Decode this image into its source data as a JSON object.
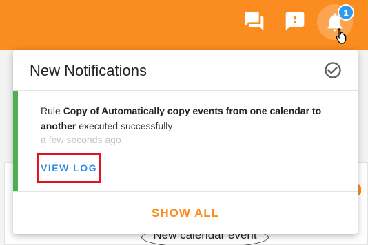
{
  "topbar": {
    "accent_color": "#fb8c1f",
    "icons": [
      "chat-icon",
      "feedback-icon",
      "bell-icon"
    ],
    "notification_count": "1"
  },
  "background": {
    "event_label": "New calendar event"
  },
  "notifications_panel": {
    "title": "New Notifications",
    "mark_read_icon": "check-circle-icon",
    "items": [
      {
        "prefix": "Rule ",
        "rule_name": "Copy of Automatically copy events from one calendar to another",
        "suffix": " executed successfully",
        "time": "a few seconds ago",
        "action_label": "VIEW LOG",
        "status_color": "#4caf50"
      }
    ],
    "show_all_label": "SHOW ALL"
  }
}
